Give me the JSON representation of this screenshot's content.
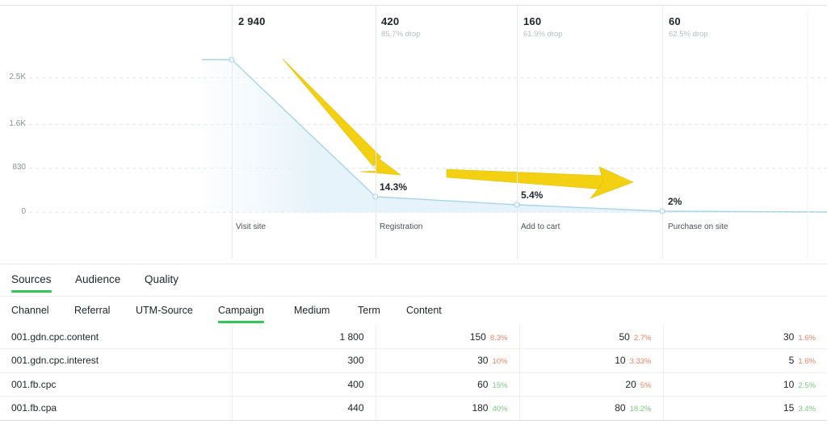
{
  "chart_data": {
    "type": "area",
    "title": "",
    "categories": [
      "Visit site",
      "Registration",
      "Add to cart",
      "Purchase on site"
    ],
    "values": [
      2940,
      420,
      160,
      60
    ],
    "value_labels": [
      "2 940",
      "420",
      "160",
      "60"
    ],
    "drop_labels": [
      "",
      "85.7% drop",
      "61.9% drop",
      "62.5% drop"
    ],
    "conversion_labels": [
      "",
      "14.3%",
      "5.4%",
      "2%"
    ],
    "ylabel": "",
    "xlabel": "",
    "ytick_labels": [
      "2.5K",
      "1.6K",
      "830",
      "0"
    ],
    "ytick_values": [
      2500,
      1600,
      830,
      0
    ],
    "ylim": [
      0,
      3300
    ],
    "grid": true,
    "legend": "none",
    "line_color": "#a8d4e8",
    "area_color": "#e8f4fb",
    "annotations": [
      {
        "name": "drop-arrow",
        "type": "arrow",
        "direction": "down-right",
        "color": "#f5d414"
      },
      {
        "name": "flat-arrow",
        "type": "arrow",
        "direction": "right",
        "color": "#f5d414"
      }
    ]
  },
  "funnel": {
    "steps": [
      {
        "value": "2 940",
        "drop": "",
        "pct": "",
        "label": "Visit site"
      },
      {
        "value": "420",
        "drop": "85.7% drop",
        "pct": "14.3%",
        "label": "Registration"
      },
      {
        "value": "160",
        "drop": "61.9% drop",
        "pct": "5.4%",
        "label": "Add to cart"
      },
      {
        "value": "60",
        "drop": "62.5% drop",
        "pct": "2%",
        "label": "Purchase on site"
      }
    ],
    "yticks": [
      "2.5K",
      "1.6K",
      "830",
      "0"
    ]
  },
  "tabs_primary": [
    {
      "label": "Sources",
      "active": true
    },
    {
      "label": "Audience",
      "active": false
    },
    {
      "label": "Quality",
      "active": false
    }
  ],
  "tabs_secondary": [
    {
      "label": "Channel",
      "active": false
    },
    {
      "label": "Referral",
      "active": false
    },
    {
      "label": "UTM-Source",
      "active": false
    },
    {
      "label": "Campaign",
      "active": true
    },
    {
      "label": "Medium",
      "active": false
    },
    {
      "label": "Term",
      "active": false
    },
    {
      "label": "Content",
      "active": false
    }
  ],
  "table": {
    "rows": [
      {
        "name": "001.gdn.cpc.content",
        "c1": {
          "n": "1 800",
          "p": "",
          "dir": ""
        },
        "c2": {
          "n": "150",
          "p": "8.3%",
          "dir": "down"
        },
        "c3": {
          "n": "50",
          "p": "2.7%",
          "dir": "down"
        },
        "c4": {
          "n": "30",
          "p": "1.6%",
          "dir": "down"
        }
      },
      {
        "name": "001.gdn.cpc.interest",
        "c1": {
          "n": "300",
          "p": "",
          "dir": ""
        },
        "c2": {
          "n": "30",
          "p": "10%",
          "dir": "down"
        },
        "c3": {
          "n": "10",
          "p": "3.33%",
          "dir": "down"
        },
        "c4": {
          "n": "5",
          "p": "1.6%",
          "dir": "down"
        }
      },
      {
        "name": "001.fb.cpc",
        "c1": {
          "n": "400",
          "p": "",
          "dir": ""
        },
        "c2": {
          "n": "60",
          "p": "15%",
          "dir": "up"
        },
        "c3": {
          "n": "20",
          "p": "5%",
          "dir": "down"
        },
        "c4": {
          "n": "10",
          "p": "2.5%",
          "dir": "up"
        }
      },
      {
        "name": "001.fb.cpa",
        "c1": {
          "n": "440",
          "p": "",
          "dir": ""
        },
        "c2": {
          "n": "180",
          "p": "40%",
          "dir": "up"
        },
        "c3": {
          "n": "80",
          "p": "18.2%",
          "dir": "up"
        },
        "c4": {
          "n": "15",
          "p": "3.4%",
          "dir": "up"
        }
      }
    ]
  },
  "colors": {
    "accent_green": "#35c455",
    "arrow_yellow": "#f5d414",
    "line_blue": "#a8d4e8",
    "area_blue": "#e8f4fb",
    "pct_down": "#e8836a",
    "pct_up": "#7fc47f"
  }
}
